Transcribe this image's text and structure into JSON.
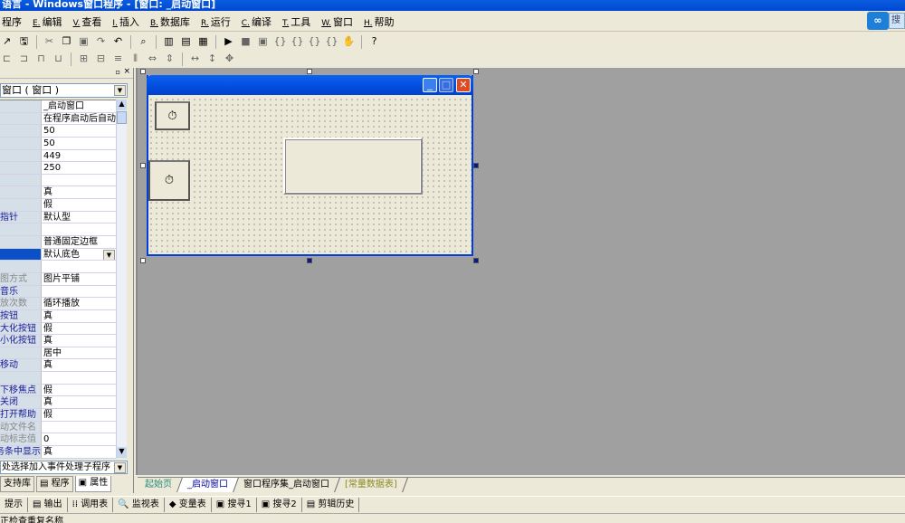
{
  "window_title": "语言 - Windows窗口程序 - [窗口: _启动窗口]",
  "menu": [
    {
      "key": "",
      "label": "程序"
    },
    {
      "key": "E.",
      "label": "编辑"
    },
    {
      "key": "V.",
      "label": "查看"
    },
    {
      "key": "I.",
      "label": "插入"
    },
    {
      "key": "B.",
      "label": "数据库"
    },
    {
      "key": "R.",
      "label": "运行"
    },
    {
      "key": "C.",
      "label": "编译"
    },
    {
      "key": "T.",
      "label": "工具"
    },
    {
      "key": "W.",
      "label": "窗口"
    },
    {
      "key": "H.",
      "label": "帮助"
    }
  ],
  "cloud_button_text": "搜",
  "properties": {
    "object_selector": "窗口 ( 窗口 )",
    "rows": [
      {
        "k": "",
        "v": "_启动窗口"
      },
      {
        "k": "",
        "v": "在程序启动后自动"
      },
      {
        "k": "",
        "v": "50"
      },
      {
        "k": "",
        "v": "50"
      },
      {
        "k": "",
        "v": "449"
      },
      {
        "k": "",
        "v": "250"
      },
      {
        "k": "",
        "v": ""
      },
      {
        "k": "",
        "v": "真"
      },
      {
        "k": "",
        "v": "假"
      },
      {
        "k": "指针",
        "v": "默认型"
      },
      {
        "k": "",
        "v": ""
      },
      {
        "k": "",
        "v": "普通固定边框"
      },
      {
        "k": "",
        "v": "默认底色",
        "selected": true
      },
      {
        "k": "",
        "v": ""
      },
      {
        "k": "图方式",
        "v": "图片平铺",
        "gray": true
      },
      {
        "k": "音乐",
        "v": ""
      },
      {
        "k": "放次数",
        "v": "循环播放",
        "gray": true
      },
      {
        "k": "按钮",
        "v": "真"
      },
      {
        "k": "大化按钮",
        "v": "假"
      },
      {
        "k": "小化按钮",
        "v": "真"
      },
      {
        "k": "",
        "v": "居中"
      },
      {
        "k": "移动",
        "v": "真"
      },
      {
        "k": "",
        "v": ""
      },
      {
        "k": "下移焦点",
        "v": "假"
      },
      {
        "k": "关闭",
        "v": "真"
      },
      {
        "k": "打开帮助",
        "v": "假"
      },
      {
        "k": "动文件名",
        "v": "",
        "gray": true
      },
      {
        "k": "动标志值",
        "v": "0",
        "gray": true
      },
      {
        "k": "务条中显示",
        "v": "真"
      }
    ],
    "event_selector": "处选择加入事件处理子程序"
  },
  "left_tabs": [
    "支持库",
    "程序",
    "属性"
  ],
  "doc_tabs": [
    {
      "label": "起始页",
      "color": "#2a8a7a"
    },
    {
      "label": "_启动窗口",
      "color": "#0000a0"
    },
    {
      "label": "窗口程序集_启动窗口",
      "color": "#000000"
    },
    {
      "label": "[常量数据表]",
      "color": "#8a8a20"
    }
  ],
  "bottom_tabs": [
    "提示",
    "输出",
    "调用表",
    "监视表",
    "变量表",
    "搜寻1",
    "搜寻2",
    "剪辑历史"
  ],
  "status_text": "正检查重复名称"
}
